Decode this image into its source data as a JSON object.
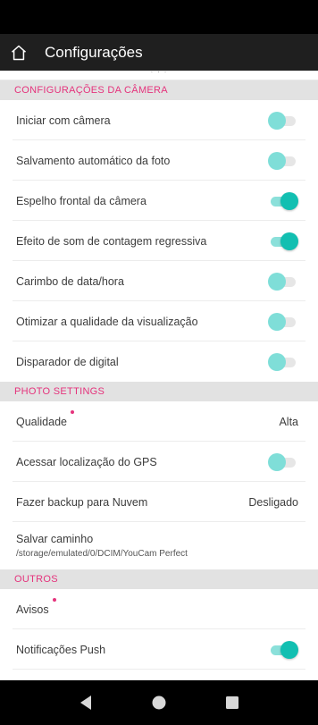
{
  "app_bar": {
    "title": "Configurações",
    "home_icon": "home-icon"
  },
  "colors": {
    "accent": "#e5337c",
    "toggle_on": "#12bfb1",
    "toggle_off": "#7fded8",
    "app_bar": "#1f1f1f"
  },
  "sections": [
    {
      "header": "CONFIGURAÇÕES DA CÂMERA",
      "rows": [
        {
          "label": "Iniciar com câmera",
          "toggle": false
        },
        {
          "label": "Salvamento automático da foto",
          "toggle": false
        },
        {
          "label": "Espelho frontal da câmera",
          "toggle": true
        },
        {
          "label": "Efeito de som de contagem regressiva",
          "toggle": true
        },
        {
          "label": "Carimbo de data/hora",
          "toggle": false
        },
        {
          "label": "Otimizar a qualidade da visualização",
          "toggle": false
        },
        {
          "label": "Disparador de digital",
          "toggle": false
        }
      ]
    },
    {
      "header": "PHOTO SETTINGS",
      "rows": [
        {
          "label": "Qualidade",
          "value": "Alta",
          "new_dot": true
        },
        {
          "label": "Acessar localização do GPS",
          "toggle": false
        },
        {
          "label": "Fazer backup para Nuvem",
          "value": "Desligado"
        },
        {
          "label": "Salvar caminho",
          "sublabel": "/storage/emulated/0/DCIM/YouCam Perfect"
        }
      ]
    },
    {
      "header": "OUTROS",
      "rows": [
        {
          "label": "Avisos",
          "new_dot": true
        },
        {
          "label": "Notificações Push",
          "toggle": true
        }
      ]
    }
  ],
  "nav_bar": {
    "back_icon": "back-triangle-icon",
    "home_icon": "home-circle-icon",
    "recents_icon": "recents-square-icon"
  }
}
